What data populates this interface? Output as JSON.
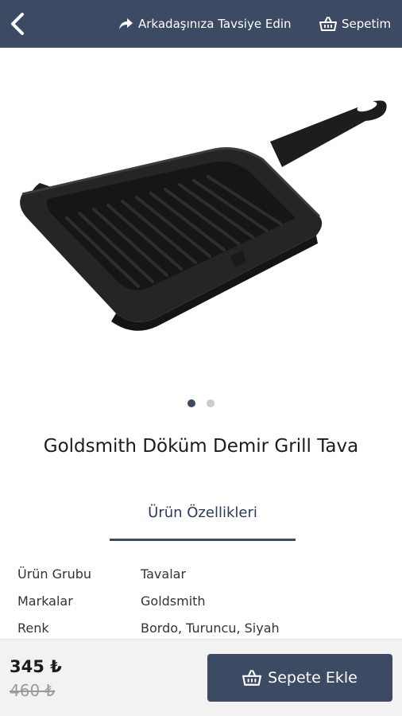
{
  "header": {
    "back_icon": "chevron-left-icon",
    "share_label": "Arkadaşınıza Tavsiye Edin",
    "share_icon": "share-arrow-icon",
    "cart_label": "Sepetim",
    "cart_icon": "basket-icon"
  },
  "gallery": {
    "image_subject": "square cast iron grill pan",
    "dots_count": 2,
    "active_index": 0
  },
  "product": {
    "title": "Goldsmith Döküm Demir Grill Tava"
  },
  "tabs": {
    "features_label": "Ürün Özellikleri"
  },
  "specs": [
    {
      "key": "Ürün Grubu",
      "value": "Tavalar"
    },
    {
      "key": "Markalar",
      "value": "Goldsmith"
    },
    {
      "key": "Renk",
      "value": "Bordo, Turuncu, Siyah"
    }
  ],
  "footer": {
    "price": "345 ₺",
    "old_price": "460 ₺",
    "add_to_cart_label": "Sepete Ekle",
    "add_to_cart_icon": "basket-icon"
  },
  "colors": {
    "primary": "#3d4a63",
    "accent_text": "#2c3a5c",
    "footer_bg": "#f2f2f2"
  }
}
